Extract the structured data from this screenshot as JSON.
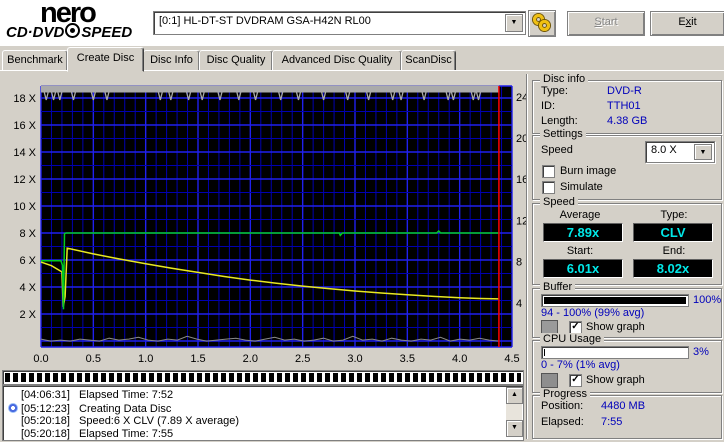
{
  "header": {
    "logo": {
      "line1": "nero",
      "line2_left": "CD·DVD",
      "line2_right": "SPEED"
    },
    "drive_select": {
      "value": "[0:1]   HL-DT-ST DVDRAM GSA-H42N RL00"
    },
    "tools_button": {
      "icon": "gears-icon"
    },
    "start_button": {
      "parts": [
        "",
        "S",
        "tart"
      ],
      "disabled": true
    },
    "exit_button": {
      "parts": [
        "E",
        "x",
        "it"
      ],
      "disabled": false
    }
  },
  "tabs": [
    {
      "label": "Benchmark",
      "active": false
    },
    {
      "label": "Create Disc",
      "active": true
    },
    {
      "label": "Disc Info",
      "active": false
    },
    {
      "label": "Disc Quality",
      "active": false
    },
    {
      "label": "Advanced Disc Quality",
      "active": false
    },
    {
      "label": "ScanDisc",
      "active": false
    }
  ],
  "chart_data": {
    "type": "line",
    "title": "Create Disc write test graph",
    "x_axis": {
      "min": 0,
      "max": 4.5,
      "unit": "GB",
      "tick_labels": [
        "0.0",
        "0.5",
        "1.0",
        "1.5",
        "2.0",
        "2.5",
        "3.0",
        "3.5",
        "4.0",
        "4.5"
      ]
    },
    "y_left_axis": {
      "unit": "X speed",
      "tick_values": [
        18,
        16,
        14,
        12,
        10,
        8,
        6,
        4,
        2
      ],
      "tick_labels": [
        "18 X",
        "16 X",
        "14 X",
        "12 X",
        "10 X",
        "8 X",
        "6 X",
        "4 X",
        "2 X"
      ]
    },
    "y_right_axis": {
      "unit": "x1000 RPM",
      "tick_values": [
        24,
        20,
        16,
        12,
        8,
        4
      ],
      "tick_labels": [
        "24",
        "20",
        "16",
        "12",
        "8",
        "4"
      ]
    },
    "grid": {
      "bg": "#000000",
      "major": "#2020ee",
      "minor": "#0000b0"
    },
    "end_line": {
      "x": 4.375,
      "color": "#ff0000"
    },
    "series": [
      {
        "name": "write-speed",
        "axis": "left",
        "color": "#00cc22",
        "points": [
          [
            0,
            5.95
          ],
          [
            0.19,
            5.95
          ],
          [
            0.205,
            5.6
          ],
          [
            0.215,
            2.35
          ],
          [
            0.225,
            7.95
          ],
          [
            0.24,
            8.0
          ],
          [
            2.85,
            8.0
          ],
          [
            2.86,
            7.82
          ],
          [
            2.88,
            8.0
          ],
          [
            3.78,
            8.0
          ],
          [
            3.8,
            8.15
          ],
          [
            3.82,
            8.0
          ],
          [
            4.375,
            8.0
          ]
        ]
      },
      {
        "name": "rotation-speed",
        "axis": "right",
        "color": "#e8e822",
        "points": [
          [
            0,
            7.95
          ],
          [
            0.1,
            7.6
          ],
          [
            0.2,
            7.0
          ],
          [
            0.212,
            3.6
          ],
          [
            0.23,
            4.6
          ],
          [
            0.25,
            9.3
          ],
          [
            0.5,
            8.75
          ],
          [
            0.75,
            8.25
          ],
          [
            1.0,
            7.8
          ],
          [
            1.25,
            7.35
          ],
          [
            1.5,
            6.95
          ],
          [
            1.75,
            6.55
          ],
          [
            2.0,
            6.2
          ],
          [
            2.25,
            5.9
          ],
          [
            2.5,
            5.62
          ],
          [
            2.75,
            5.38
          ],
          [
            3.0,
            5.15
          ],
          [
            3.25,
            4.95
          ],
          [
            3.5,
            4.78
          ],
          [
            3.75,
            4.62
          ],
          [
            4.0,
            4.5
          ],
          [
            4.2,
            4.42
          ],
          [
            4.375,
            4.38
          ]
        ]
      },
      {
        "name": "buffer-level",
        "axis": "top-band",
        "color": "#aaaaaa",
        "band_pct": 100,
        "range_pct": [
          94,
          100
        ],
        "dip_x": [
          0.05,
          0.12,
          0.18,
          0.31,
          0.5,
          0.63,
          1.14,
          1.24,
          1.41,
          1.54,
          1.71,
          1.89,
          2.05,
          2.29,
          2.46,
          2.7,
          2.93,
          3.13,
          3.36,
          3.44,
          3.66,
          3.89,
          3.94,
          4.13,
          4.18
        ]
      },
      {
        "name": "cpu-usage",
        "axis": "bottom-band",
        "color": "#8a8a8a",
        "range_pct": [
          0,
          7
        ],
        "values": [
          3,
          1,
          2,
          1,
          3,
          2,
          1,
          4,
          2,
          3,
          5,
          2,
          1,
          3,
          2,
          6,
          3,
          1,
          2,
          3,
          4,
          2,
          1,
          3,
          5,
          2,
          3,
          1,
          2,
          4,
          1,
          2,
          6,
          2,
          3,
          1,
          4,
          2,
          1,
          3,
          2,
          5,
          1,
          3,
          2,
          4,
          2,
          1
        ]
      }
    ]
  },
  "panels": {
    "disc_info": {
      "title": "Disc info",
      "rows": [
        {
          "label": "Type:",
          "value": "DVD-R"
        },
        {
          "label": "ID:",
          "value": "TTH01"
        },
        {
          "label": "Length:",
          "value": "4.38 GB"
        }
      ]
    },
    "settings": {
      "title": "Settings",
      "speed_label": "Speed",
      "speed_value": "8.0 X",
      "checkboxes": [
        {
          "label": "Burn image",
          "checked": false
        },
        {
          "label": "Simulate",
          "checked": false
        }
      ]
    },
    "speed": {
      "title": "Speed",
      "cells": [
        {
          "label": "Average",
          "value": "7.89x"
        },
        {
          "label": "Type:",
          "value": "CLV"
        },
        {
          "label": "Start:",
          "value": "6.01x"
        },
        {
          "label": "End:",
          "value": "8.02x"
        }
      ]
    },
    "buffer": {
      "title": "Buffer",
      "percent": 100,
      "percent_label": "100%",
      "range_label": "94 - 100% (99% avg)",
      "show_graph_label": "Show graph",
      "checked": true,
      "swatch_color": "#9a9a9a"
    },
    "cpu": {
      "title": "CPU Usage",
      "percent": 3,
      "percent_label": "3%",
      "range_label": "0 - 7% (1% avg)",
      "show_graph_label": "Show graph",
      "checked": true,
      "swatch_color": "#8e8e8e"
    },
    "progress": {
      "title": "Progress",
      "rows": [
        {
          "label": "Position:",
          "value": "4480 MB"
        },
        {
          "label": "Elapsed:",
          "value": "7:55"
        }
      ]
    }
  },
  "log": {
    "entries": [
      {
        "time": "[04:06:31]",
        "text": "Elapsed Time:  7:52",
        "icon": ""
      },
      {
        "time": "[05:12:23]",
        "text": "Creating Data Disc",
        "icon": "disc-icon"
      },
      {
        "time": "[05:20:18]",
        "text": "Speed:6 X CLV (7.89 X average)",
        "icon": ""
      },
      {
        "time": "[05:20:18]",
        "text": "Elapsed Time:  7:55",
        "icon": ""
      }
    ]
  },
  "colors": {
    "value_blue": "#0000bb",
    "lcd_cyan": "#00e8e8"
  }
}
